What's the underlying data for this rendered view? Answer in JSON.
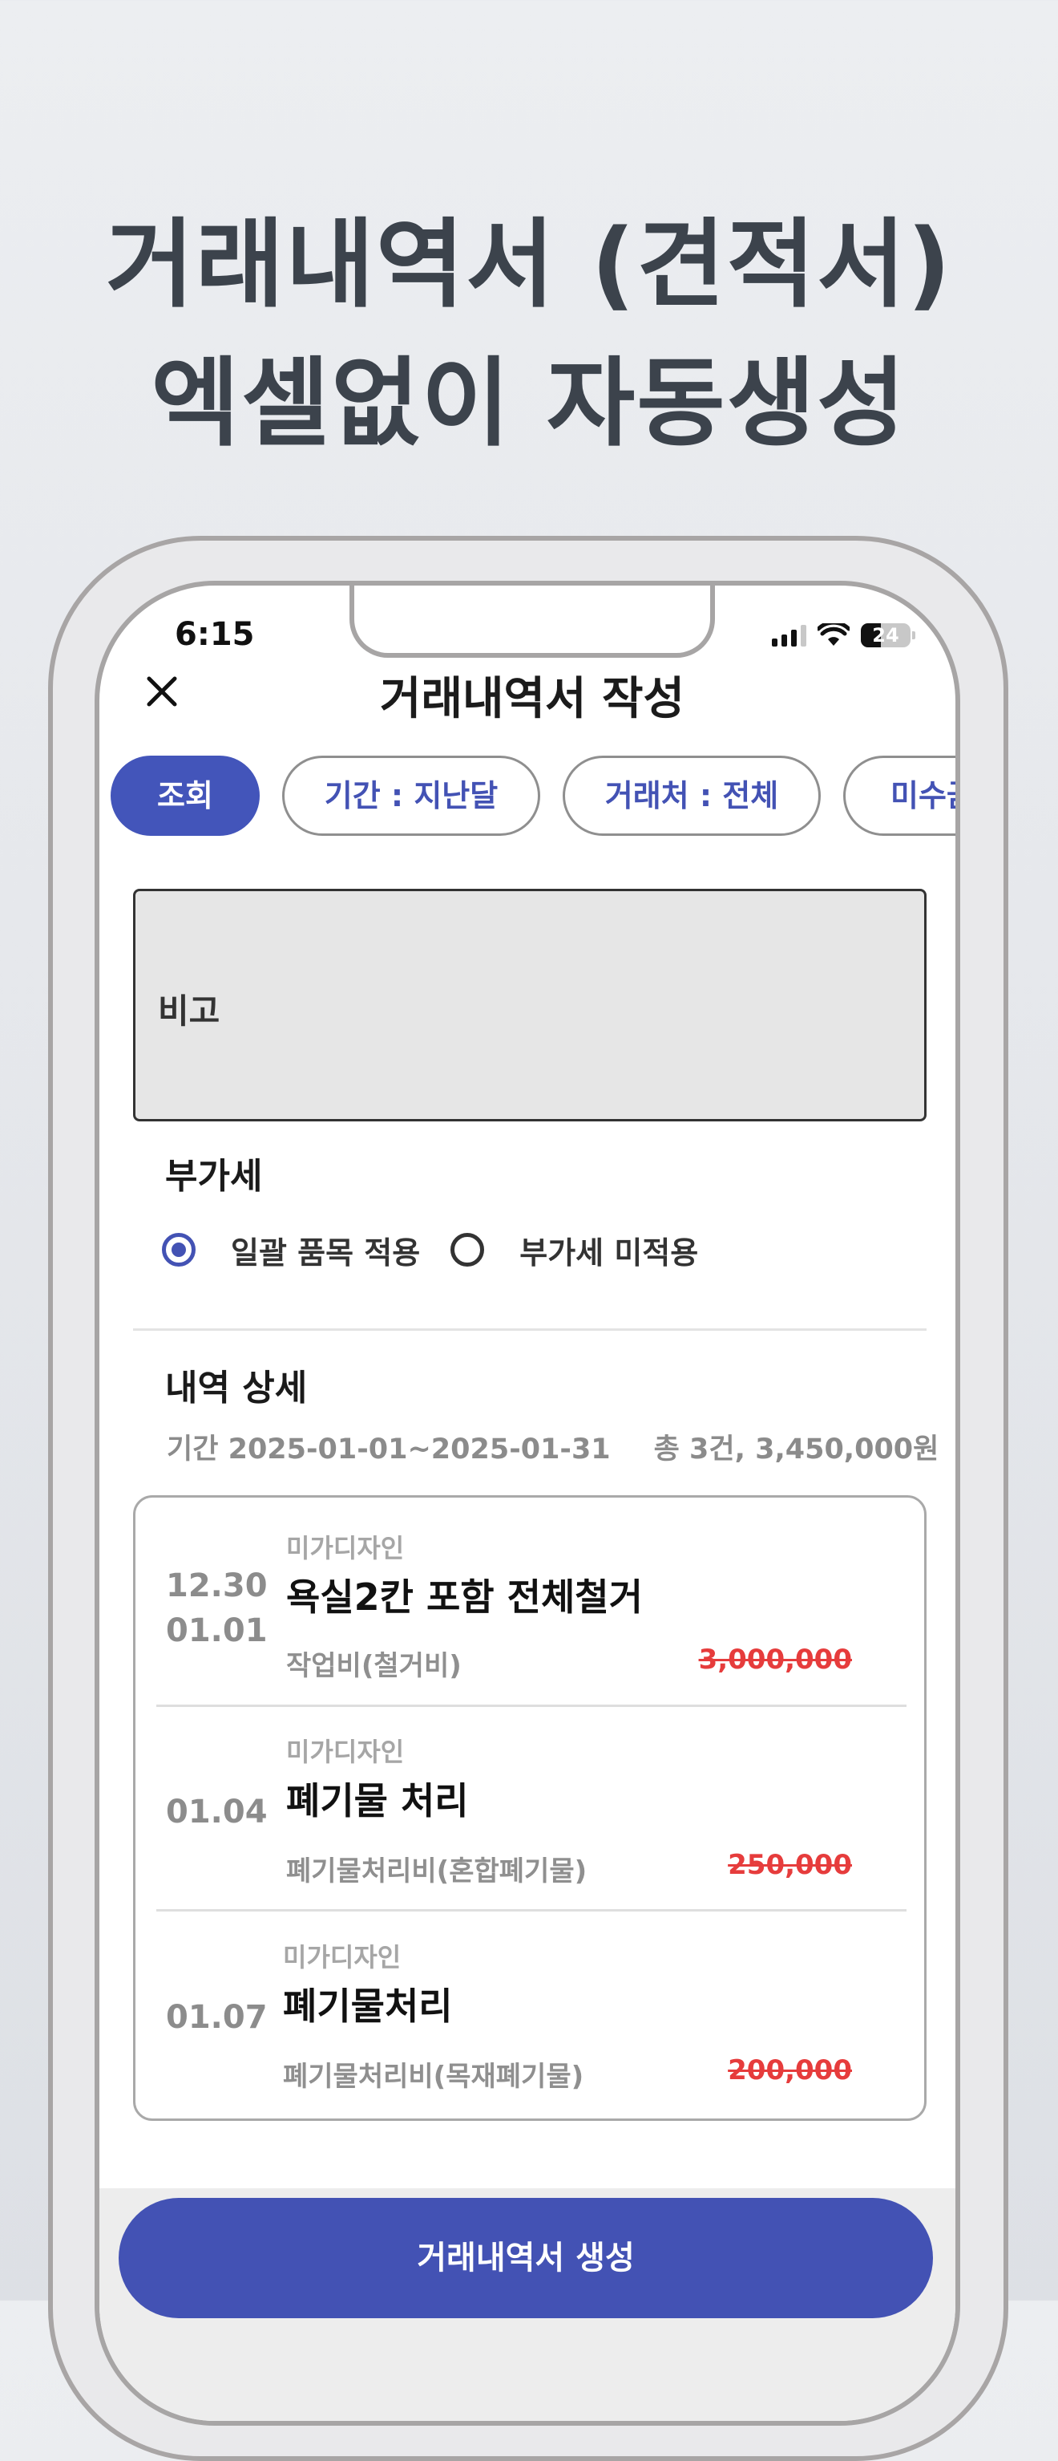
{
  "promo": {
    "line1": "거래내역서 (견적서)",
    "line2": "엑셀없이 자동생성"
  },
  "status_bar": {
    "time": "6:15",
    "battery": "24"
  },
  "header": {
    "title": "거래내역서 작성",
    "close_icon": "close-icon"
  },
  "filters": [
    {
      "label": "조회",
      "active": true
    },
    {
      "label": "기간 : 지난달",
      "active": false
    },
    {
      "label": "거래처 : 전체",
      "active": false
    },
    {
      "label": "미수금",
      "active": false
    }
  ],
  "memo": {
    "label": "비고"
  },
  "vat": {
    "title": "부가세",
    "options": [
      {
        "label": "일괄 품목 적용",
        "selected": true
      },
      {
        "label": "부가세 미적용",
        "selected": false
      }
    ]
  },
  "details": {
    "title": "내역 상세",
    "period": "기간 2025-01-01~2025-01-31",
    "total": "총 3건, 3,450,000원",
    "items": [
      {
        "date1": "12.30",
        "date2": "01.01",
        "client": "미가디자인",
        "name": "욕실2칸 포함 전체철거",
        "category": "작업비(철거비)",
        "amount": "3,000,000"
      },
      {
        "date1": "01.04",
        "date2": "",
        "client": "미가디자인",
        "name": "폐기물 처리",
        "category": "폐기물처리비(혼합폐기물)",
        "amount": "250,000"
      },
      {
        "date1": "01.07",
        "date2": "",
        "client": "미가디자인",
        "name": "폐기물처리",
        "category": "폐기물처리비(목재폐기물)",
        "amount": "200,000"
      }
    ]
  },
  "cta": {
    "label": "거래내역서 생성"
  },
  "colors": {
    "accent": "#4352b4",
    "strike_amount": "#e63c3c"
  }
}
